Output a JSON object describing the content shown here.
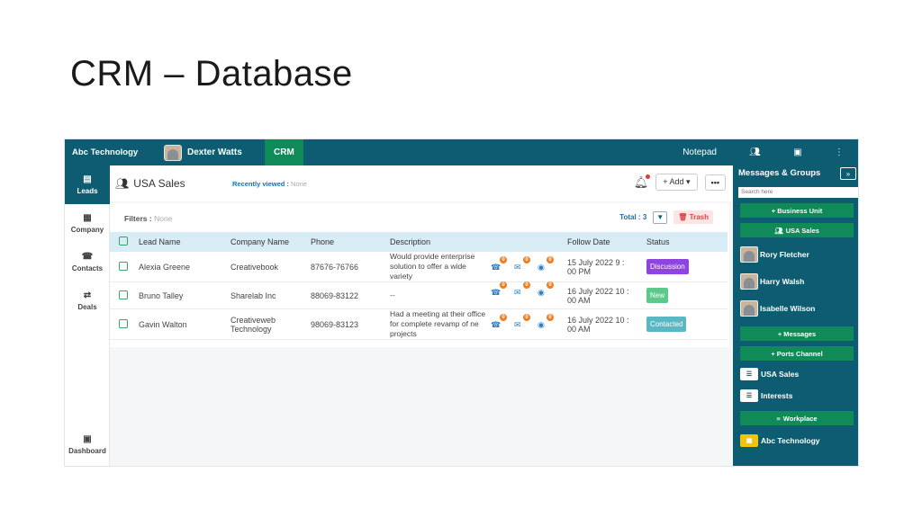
{
  "slide": {
    "title": "CRM – Database"
  },
  "topbar": {
    "brand": "Abc Technology",
    "user_name": "Dexter Watts",
    "crm_tab": "CRM",
    "notepad": "Notepad"
  },
  "header": {
    "group_name": "USA Sales",
    "recent_label": "Recently viewed :",
    "recent_value": "None",
    "add_label": "+ Add ▾",
    "more_label": "•••"
  },
  "filters": {
    "label": "Filters :",
    "value": "None",
    "total_label": "Total : 3",
    "trash_label": "Trash"
  },
  "leftnav": {
    "items": [
      {
        "label": "Leads",
        "icon": "id-card-icon"
      },
      {
        "label": "Company",
        "icon": "building-icon"
      },
      {
        "label": "Contacts",
        "icon": "phone-icon"
      },
      {
        "label": "Deals",
        "icon": "handshake-icon"
      }
    ],
    "dashboard": "Dashboard"
  },
  "table": {
    "columns": [
      "Lead Name",
      "Company Name",
      "Phone",
      "Description",
      "Follow Date",
      "Status"
    ],
    "rows": [
      {
        "name": "Alexia Greene",
        "company_lines": [
          "Creativebook"
        ],
        "phone": "87676-76766",
        "desc_lines": [
          "Would provide enterprise",
          "solution to offer a wide",
          "variety"
        ],
        "follow_lines": [
          "15 July 2022 9 :",
          "00 PM"
        ],
        "status": "Discussion",
        "status_color": "#8e44e0"
      },
      {
        "name": "Bruno Talley",
        "company_lines": [
          "Sharelab Inc"
        ],
        "phone": "88069-83122",
        "desc_lines": [
          "--"
        ],
        "follow_lines": [
          "16 July 2022 10 :",
          "00 AM"
        ],
        "status": "New",
        "status_color": "#5cc98a"
      },
      {
        "name": "Gavin Walton",
        "company_lines": [
          "Creativeweb",
          "Technology"
        ],
        "phone": "98069-83123",
        "desc_lines": [
          "Had a meeting at their office",
          "for complete revamp of ne",
          "projects"
        ],
        "follow_lines": [
          "16 July 2022 10 :",
          "00 AM"
        ],
        "status": "Contacted",
        "status_color": "#5ab8c4"
      }
    ]
  },
  "rpanel": {
    "title": "Messages & Groups",
    "search_placeholder": "Search here",
    "business_unit": "+ Business Unit",
    "usa_sales_btn": "USA Sales",
    "people": [
      "Rory Fletcher",
      "Harry Walsh",
      "Isabelle Wilson"
    ],
    "messages_btn": "+ Messages",
    "ports_btn": "+ Ports Channel",
    "groups": [
      "USA Sales",
      "Interests"
    ],
    "workplace_btn": "Workplace",
    "org": "Abc Technology"
  }
}
